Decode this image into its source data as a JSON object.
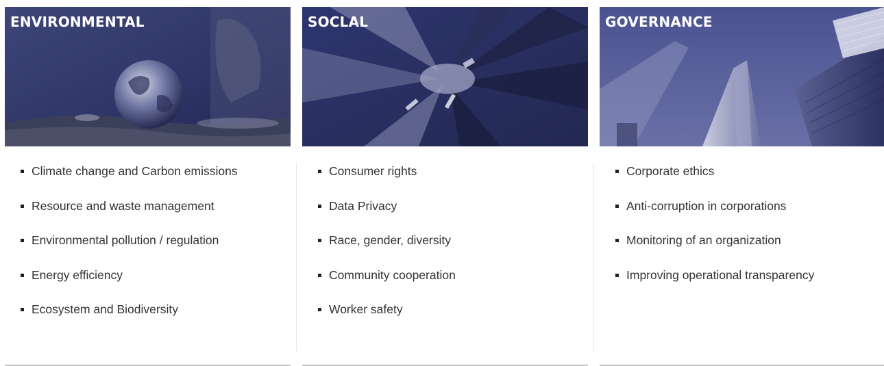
{
  "columns": [
    {
      "title": "ENVIRONMENTAL",
      "items": [
        "Climate change and Carbon emissions",
        "Resource and waste management",
        "Environmental pollution / regulation",
        "Energy efficiency",
        "Ecosystem and Biodiversity"
      ]
    },
    {
      "title": "SOCLAL",
      "items": [
        "Consumer rights",
        "Data Privacy",
        "Race, gender, diversity",
        "Community cooperation",
        "Worker safety"
      ]
    },
    {
      "title": "GOVERNANCE",
      "items": [
        "Corporate ethics",
        "Anti-corruption in corporations",
        "Monitoring of an organization",
        "Improving operational transparency"
      ]
    }
  ],
  "colors": {
    "banner_overlay": "#2a2f6e",
    "text": "#333333",
    "bullet": "#222222"
  },
  "icons": [
    "globe-image",
    "hands-image",
    "skyscrapers-image"
  ]
}
